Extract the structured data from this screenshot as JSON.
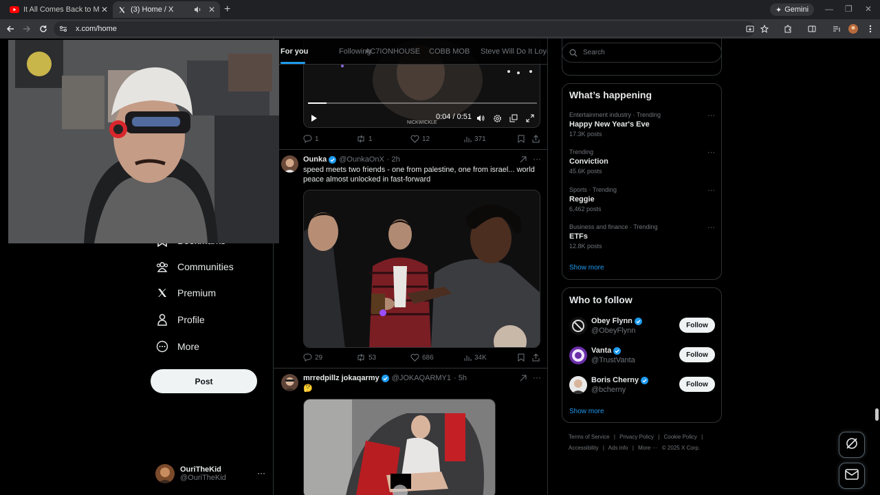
{
  "browser": {
    "tabs": [
      {
        "title": "It All Comes Back to Me - Baby",
        "icon": "youtube-icon"
      },
      {
        "title": "(3) Home / X",
        "icon": "x-logo-icon"
      }
    ],
    "gemini_label": "Gemini",
    "url": "x.com/home"
  },
  "left_nav": {
    "items": [
      {
        "label": "Bookmarks",
        "icon": "bookmark-icon"
      },
      {
        "label": "Communities",
        "icon": "communities-icon"
      },
      {
        "label": "Premium",
        "icon": "x-logo-icon"
      },
      {
        "label": "Profile",
        "icon": "person-icon"
      },
      {
        "label": "More",
        "icon": "more-circle-icon"
      }
    ],
    "post_label": "Post",
    "account": {
      "name": "OuriTheKid",
      "handle": "@OuriTheKid"
    }
  },
  "feed": {
    "tabs": [
      "For you",
      "Following",
      "AC7IONHOUSE",
      "COBB MOB",
      "Steve Will Do It Loyal"
    ],
    "video": {
      "time": "0:04 / 0:51",
      "progress": 0.08,
      "watermark": "NICKWICKLE"
    },
    "post1_stats": {
      "replies": "1",
      "reposts": "1",
      "likes": "12",
      "views": "371"
    },
    "post2": {
      "name": "Ounka",
      "handle": "@OunkaOnX",
      "time": "· 2h",
      "text": "speed meets two friends - one from palestine, one from israel... world peace almost unlocked in fast-forward",
      "stats": {
        "replies": "29",
        "reposts": "53",
        "likes": "686",
        "views": "34K"
      }
    },
    "post3": {
      "name": "mrredpillz jokaqarmy",
      "handle": "@JOKAQARMY1",
      "time": "· 5h",
      "text": "🤔"
    }
  },
  "right": {
    "search_placeholder": "Search",
    "whats_happening_title": "What’s happening",
    "trends": [
      {
        "category": "Entertainment industry · Trending",
        "name": "Happy New Year's Eve",
        "count": "17.3K posts"
      },
      {
        "category": "Trending",
        "name": "Conviction",
        "count": "45.6K posts"
      },
      {
        "category": "Sports · Trending",
        "name": "Reggie",
        "count": "6,462 posts"
      },
      {
        "category": "Business and finance · Trending",
        "name": "ETFs",
        "count": "12.8K posts"
      }
    ],
    "show_more": "Show more",
    "who_to_follow_title": "Who to follow",
    "follow_label": "Follow",
    "suggestions": [
      {
        "name": "Obey Flynn",
        "handle": "@ObeyFlynn"
      },
      {
        "name": "Vanta",
        "handle": "@TrustVanta"
      },
      {
        "name": "Boris Cherny",
        "handle": "@bcherny"
      }
    ],
    "footer": [
      "Terms of Service",
      "|",
      "Privacy Policy",
      "|",
      "Cookie Policy",
      "|",
      "Accessibility",
      "|",
      "Ads info",
      "|",
      "More ···",
      "© 2025 X Corp."
    ]
  },
  "colors": {
    "accent": "#1d9bf0",
    "background": "#000000",
    "border": "#2f3336",
    "muted": "#71767b"
  }
}
